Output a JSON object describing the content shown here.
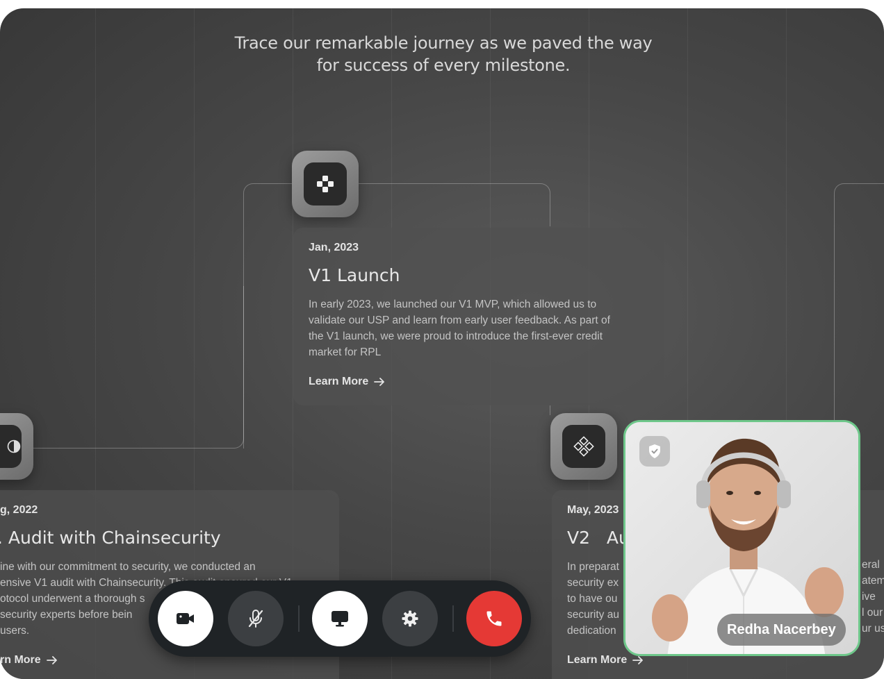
{
  "intro": {
    "line1": "Trace our remarkable journey as we paved the way",
    "line2": "for success of every milestone."
  },
  "milestones": [
    {
      "date": "g, 2022",
      "title": ". Audit with Chainsecurity",
      "desc_lines": [
        "ine with our commitment to security, we conducted an",
        "ensive V1 audit with Chainsecurity. This audit ensured our V1",
        "otocol underwent a thorough s",
        "security experts before bein",
        "users."
      ],
      "more": "rn More"
    },
    {
      "date": "Jan, 2023",
      "title": "V1 Launch",
      "desc_lines": [
        "In early 2023, we launched our V1 MVP, which allowed us to",
        "validate our USP and learn from early user feedback. As part of",
        "the V1 launch, we were proud to introduce the first-ever credit",
        "market for RPL"
      ],
      "more": "Learn More"
    },
    {
      "date": "May, 2023",
      "title": "V2   Au",
      "desc_lines": [
        "In preparat",
        "security ex",
        "to have ou",
        "security au",
        "dedication"
      ],
      "desc_right": [
        "eral",
        "atem",
        "ive",
        "l our",
        "ur us"
      ],
      "more": "Learn More"
    }
  ],
  "call": {
    "participant_name": "Redha Nacerbey",
    "accent": "#6ec78a",
    "hangup_color": "#e53935",
    "icons": [
      "video-camera-icon",
      "mic-off-icon",
      "screen-share-icon",
      "settings-gear-icon",
      "phone-icon",
      "shield-check-icon"
    ]
  }
}
